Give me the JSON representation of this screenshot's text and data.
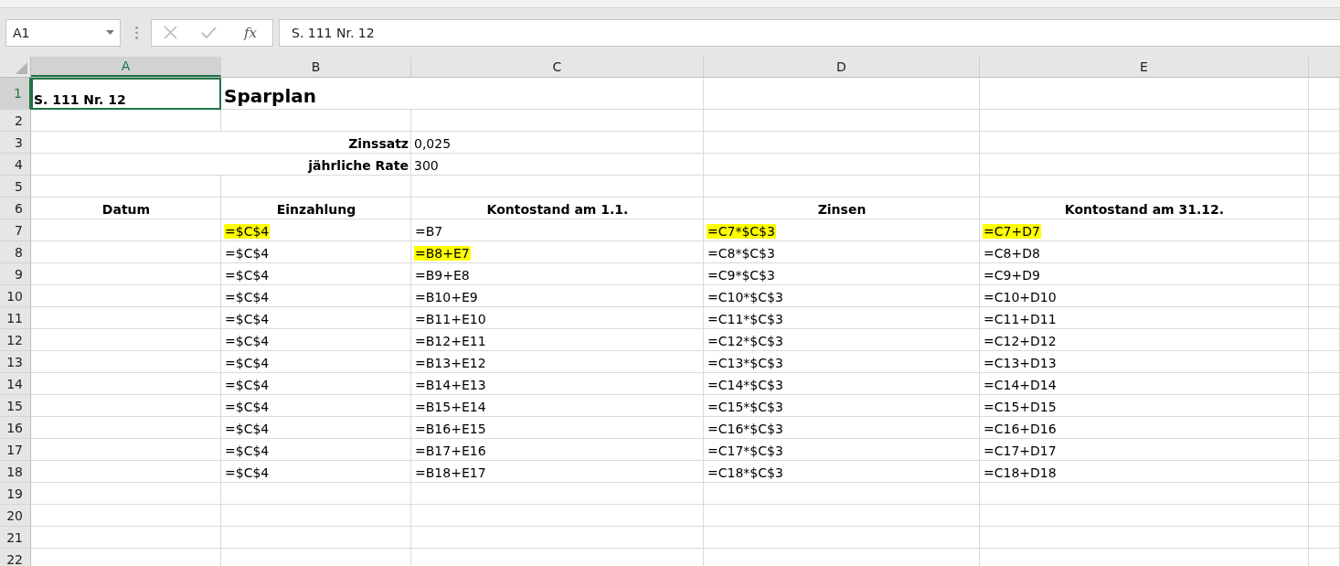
{
  "formula_bar": {
    "name_box": "A1",
    "function_button": "fx",
    "formula": "S. 111 Nr. 12"
  },
  "columns": [
    {
      "label": "A",
      "selected": true
    },
    {
      "label": "B",
      "selected": false
    },
    {
      "label": "C",
      "selected": false
    },
    {
      "label": "D",
      "selected": false
    },
    {
      "label": "E",
      "selected": false
    }
  ],
  "rows": [
    {
      "number": "1",
      "selected": true,
      "kind": "title",
      "cells": [
        {
          "text": "S. 111 Nr. 12",
          "selected": true
        },
        {
          "text": "Sparplan",
          "selected": false
        }
      ]
    },
    {
      "number": "2",
      "selected": false,
      "kind": "empty"
    },
    {
      "number": "3",
      "selected": false,
      "kind": "param",
      "cells": [
        {
          "text": "Zinssatz"
        },
        {
          "text": "0,025"
        }
      ]
    },
    {
      "number": "4",
      "selected": false,
      "kind": "param",
      "cells": [
        {
          "text": "jährliche Rate"
        },
        {
          "text": "300"
        }
      ]
    },
    {
      "number": "5",
      "selected": false,
      "kind": "empty"
    },
    {
      "number": "6",
      "selected": false,
      "kind": "header",
      "cells": [
        {
          "text": "Datum"
        },
        {
          "text": "Einzahlung"
        },
        {
          "text": "Kontostand am 1.1."
        },
        {
          "text": "Zinsen"
        },
        {
          "text": "Kontostand am 31.12."
        }
      ]
    },
    {
      "number": "7",
      "selected": false,
      "kind": "data",
      "cells": [
        {
          "text": "=$C$4",
          "highlighted": true
        },
        {
          "text": "=B7",
          "highlighted": false
        },
        {
          "text": "=C7*$C$3",
          "highlighted": true
        },
        {
          "text": "=C7+D7",
          "highlighted": true
        }
      ]
    },
    {
      "number": "8",
      "selected": false,
      "kind": "data",
      "cells": [
        {
          "text": "=$C$4",
          "highlighted": false
        },
        {
          "text": "=B8+E7",
          "highlighted": true
        },
        {
          "text": "=C8*$C$3",
          "highlighted": false
        },
        {
          "text": "=C8+D8",
          "highlighted": false
        }
      ]
    },
    {
      "number": "9",
      "selected": false,
      "kind": "data",
      "cells": [
        {
          "text": "=$C$4",
          "highlighted": false
        },
        {
          "text": "=B9+E8",
          "highlighted": false
        },
        {
          "text": "=C9*$C$3",
          "highlighted": false
        },
        {
          "text": "=C9+D9",
          "highlighted": false
        }
      ]
    },
    {
      "number": "10",
      "selected": false,
      "kind": "data",
      "cells": [
        {
          "text": "=$C$4",
          "highlighted": false
        },
        {
          "text": "=B10+E9",
          "highlighted": false
        },
        {
          "text": "=C10*$C$3",
          "highlighted": false
        },
        {
          "text": "=C10+D10",
          "highlighted": false
        }
      ]
    },
    {
      "number": "11",
      "selected": false,
      "kind": "data",
      "cells": [
        {
          "text": "=$C$4",
          "highlighted": false
        },
        {
          "text": "=B11+E10",
          "highlighted": false
        },
        {
          "text": "=C11*$C$3",
          "highlighted": false
        },
        {
          "text": "=C11+D11",
          "highlighted": false
        }
      ]
    },
    {
      "number": "12",
      "selected": false,
      "kind": "data",
      "cells": [
        {
          "text": "=$C$4",
          "highlighted": false
        },
        {
          "text": "=B12+E11",
          "highlighted": false
        },
        {
          "text": "=C12*$C$3",
          "highlighted": false
        },
        {
          "text": "=C12+D12",
          "highlighted": false
        }
      ]
    },
    {
      "number": "13",
      "selected": false,
      "kind": "data",
      "cells": [
        {
          "text": "=$C$4",
          "highlighted": false
        },
        {
          "text": "=B13+E12",
          "highlighted": false
        },
        {
          "text": "=C13*$C$3",
          "highlighted": false
        },
        {
          "text": "=C13+D13",
          "highlighted": false
        }
      ]
    },
    {
      "number": "14",
      "selected": false,
      "kind": "data",
      "cells": [
        {
          "text": "=$C$4",
          "highlighted": false
        },
        {
          "text": "=B14+E13",
          "highlighted": false
        },
        {
          "text": "=C14*$C$3",
          "highlighted": false
        },
        {
          "text": "=C14+D14",
          "highlighted": false
        }
      ]
    },
    {
      "number": "15",
      "selected": false,
      "kind": "data",
      "cells": [
        {
          "text": "=$C$4",
          "highlighted": false
        },
        {
          "text": "=B15+E14",
          "highlighted": false
        },
        {
          "text": "=C15*$C$3",
          "highlighted": false
        },
        {
          "text": "=C15+D15",
          "highlighted": false
        }
      ]
    },
    {
      "number": "16",
      "selected": false,
      "kind": "data",
      "cells": [
        {
          "text": "=$C$4",
          "highlighted": false
        },
        {
          "text": "=B16+E15",
          "highlighted": false
        },
        {
          "text": "=C16*$C$3",
          "highlighted": false
        },
        {
          "text": "=C16+D16",
          "highlighted": false
        }
      ]
    },
    {
      "number": "17",
      "selected": false,
      "kind": "data",
      "cells": [
        {
          "text": "=$C$4",
          "highlighted": false
        },
        {
          "text": "=B17+E16",
          "highlighted": false
        },
        {
          "text": "=C17*$C$3",
          "highlighted": false
        },
        {
          "text": "=C17+D17",
          "highlighted": false
        }
      ]
    },
    {
      "number": "18",
      "selected": false,
      "kind": "data",
      "cells": [
        {
          "text": "=$C$4",
          "highlighted": false
        },
        {
          "text": "=B18+E17",
          "highlighted": false
        },
        {
          "text": "=C18*$C$3",
          "highlighted": false
        },
        {
          "text": "=C18+D18",
          "highlighted": false
        }
      ]
    },
    {
      "number": "19",
      "selected": false,
      "kind": "empty"
    },
    {
      "number": "20",
      "selected": false,
      "kind": "empty"
    },
    {
      "number": "21",
      "selected": false,
      "kind": "empty"
    },
    {
      "number": "22",
      "selected": false,
      "kind": "empty"
    }
  ]
}
